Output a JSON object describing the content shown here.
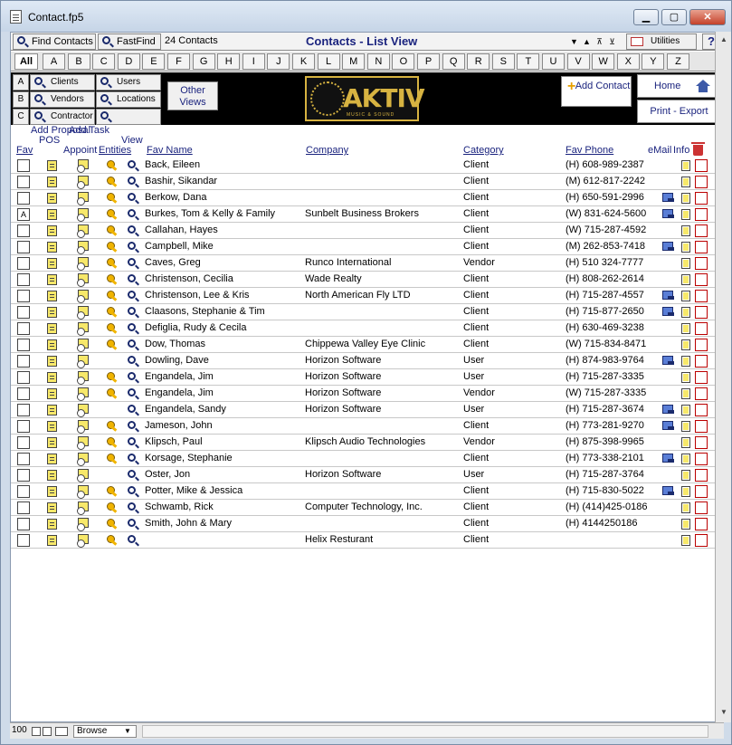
{
  "window": {
    "title": "Contact.fp5",
    "min": "▁",
    "max": "▢",
    "close": "✕"
  },
  "toolbar": {
    "find_contacts": "Find Contacts",
    "fast_find": "FastFind",
    "record_count": "24 Contacts",
    "view_title": "Contacts - List View",
    "utilities": "Utilities",
    "help": "?",
    "arrows": [
      "▼",
      "▲",
      "⊼",
      "⊻"
    ]
  },
  "letters": [
    "All",
    "A",
    "B",
    "C",
    "D",
    "E",
    "F",
    "G",
    "H",
    "I",
    "J",
    "K",
    "L",
    "M",
    "N",
    "O",
    "P",
    "Q",
    "R",
    "S",
    "T",
    "U",
    "V",
    "W",
    "X",
    "Y",
    "Z"
  ],
  "nav": {
    "row_labels": [
      "A",
      "B",
      "C"
    ],
    "entities": [
      "Clients",
      "Users",
      "Vendors",
      "Locations",
      "Contractor",
      ""
    ],
    "other_views": "Other Views",
    "logo_text": "AKTIV",
    "logo_sub": "MUSIC & SOUND",
    "add_contact": "Add Contact",
    "home": "Home",
    "print_export": "Print - Export"
  },
  "headers": {
    "fav": "Fav",
    "add_proposal": "Add Proposal",
    "pos": "POS",
    "add_task": "Add Task",
    "appoint": "Appoint",
    "entities": "Entities",
    "view": "View",
    "fav_name": "Fav Name",
    "company": "Company",
    "category": "Category",
    "fav_phone": "Fav Phone",
    "email": "eMail",
    "info": "Info"
  },
  "rows": [
    {
      "fav": "",
      "name": "Back, Eileen",
      "company": "",
      "category": "Client",
      "phone": "(H) 608-989-2387",
      "key": true,
      "mail": false
    },
    {
      "fav": "",
      "name": "Bashir, Sikandar",
      "company": "",
      "category": "Client",
      "phone": "(M) 612-817-2242",
      "key": true,
      "mail": false
    },
    {
      "fav": "",
      "name": "Berkow, Dana",
      "company": "",
      "category": "Client",
      "phone": "(H) 650-591-2996",
      "key": true,
      "mail": true
    },
    {
      "fav": "A",
      "name": "Burkes, Tom & Kelly & Family",
      "company": "Sunbelt Business Brokers",
      "category": "Client",
      "phone": "(W) 831-624-5600",
      "key": true,
      "mail": true
    },
    {
      "fav": "",
      "name": "Callahan, Hayes",
      "company": "",
      "category": "Client",
      "phone": "(W) 715-287-4592",
      "key": true,
      "mail": false
    },
    {
      "fav": "",
      "name": "Campbell, Mike",
      "company": "",
      "category": "Client",
      "phone": "(M) 262-853-7418",
      "key": true,
      "mail": true
    },
    {
      "fav": "",
      "name": "Caves, Greg",
      "company": "Runco International",
      "category": "Vendor",
      "phone": "(H) 510 324-7777",
      "key": true,
      "mail": false
    },
    {
      "fav": "",
      "name": "Christenson, Cecilia",
      "company": "Wade Realty",
      "category": "Client",
      "phone": "(H) 808-262-2614",
      "key": true,
      "mail": false
    },
    {
      "fav": "",
      "name": "Christenson, Lee & Kris",
      "company": "North American Fly LTD",
      "category": "Client",
      "phone": "(H) 715-287-4557",
      "key": true,
      "mail": true
    },
    {
      "fav": "",
      "name": "Claasons, Stephanie & Tim",
      "company": "",
      "category": "Client",
      "phone": "(H) 715-877-2650",
      "key": true,
      "mail": true
    },
    {
      "fav": "",
      "name": "Defiglia, Rudy & Cecila",
      "company": "",
      "category": "Client",
      "phone": "(H) 630-469-3238",
      "key": true,
      "mail": false
    },
    {
      "fav": "",
      "name": "Dow, Thomas",
      "company": "Chippewa Valley Eye Clinic",
      "category": "Client",
      "phone": "(W) 715-834-8471",
      "key": true,
      "mail": false
    },
    {
      "fav": "",
      "name": "Dowling, Dave",
      "company": "Horizon Software",
      "category": "User",
      "phone": "(H) 874-983-9764",
      "key": false,
      "mail": true
    },
    {
      "fav": "",
      "name": "Engandela, Jim",
      "company": "Horizon Software",
      "category": "User",
      "phone": "(H) 715-287-3335",
      "key": true,
      "mail": false
    },
    {
      "fav": "",
      "name": "Engandela, Jim",
      "company": "Horizon Software",
      "category": "Vendor",
      "phone": "(W) 715-287-3335",
      "key": true,
      "mail": false
    },
    {
      "fav": "",
      "name": "Engandela, Sandy",
      "company": "Horizon Software",
      "category": "User",
      "phone": "(H) 715-287-3674",
      "key": false,
      "mail": true
    },
    {
      "fav": "",
      "name": "Jameson, John",
      "company": "",
      "category": "Client",
      "phone": "(H) 773-281-9270",
      "key": true,
      "mail": true
    },
    {
      "fav": "",
      "name": "Klipsch, Paul",
      "company": "Klipsch Audio Technologies",
      "category": "Vendor",
      "phone": "(H) 875-398-9965",
      "key": true,
      "mail": false
    },
    {
      "fav": "",
      "name": "Korsage, Stephanie",
      "company": "",
      "category": "Client",
      "phone": "(H) 773-338-2101",
      "key": true,
      "mail": true
    },
    {
      "fav": "",
      "name": "Oster, Jon",
      "company": "Horizon Software",
      "category": "User",
      "phone": "(H) 715-287-3764",
      "key": false,
      "mail": false
    },
    {
      "fav": "",
      "name": "Potter, Mike & Jessica",
      "company": "",
      "category": "Client",
      "phone": "(H) 715-830-5022",
      "key": true,
      "mail": true
    },
    {
      "fav": "",
      "name": "Schwamb, Rick",
      "company": "Computer Technology, Inc.",
      "category": "Client",
      "phone": "(H) (414)425-0186",
      "key": true,
      "mail": false
    },
    {
      "fav": "",
      "name": "Smith, John & Mary",
      "company": "",
      "category": "Client",
      "phone": "(H) 4144250186",
      "key": true,
      "mail": false
    },
    {
      "fav": "",
      "name": "",
      "company": "Helix Resturant",
      "category": "Client",
      "phone": "",
      "key": true,
      "mail": false
    }
  ],
  "status": {
    "zoom": "100",
    "mode": "Browse",
    "mode_arrow": "▼"
  },
  "scroll": {
    "up": "▲",
    "down": "▼"
  }
}
